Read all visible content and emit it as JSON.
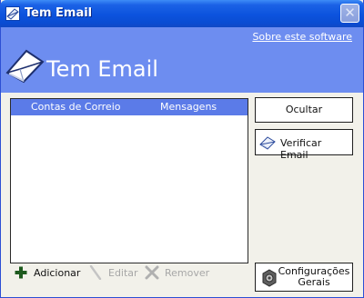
{
  "window": {
    "title": "Tem Email",
    "close_glyph": "✕"
  },
  "banner": {
    "about_link": "Sobre este software",
    "title": "Tem Email"
  },
  "list": {
    "columns": [
      "Contas de Correio",
      "Mensagens"
    ]
  },
  "buttons": {
    "hide": "Ocultar",
    "check": "Verificar Email",
    "settings_line1": "Configurações",
    "settings_line2": "Gerais"
  },
  "toolbar": {
    "add": "Adicionar",
    "edit": "Editar",
    "remove": "Remover"
  },
  "colors": {
    "titlebar": "#0c53dd",
    "banner": "#6d8df0",
    "list_header": "#5b7be8",
    "window_bg": "#f2f1ea",
    "disabled_text": "#a7a7a7"
  },
  "icons": [
    "app-mail-icon",
    "close-icon",
    "mail-logo-icon",
    "check-mail-icon",
    "add-icon",
    "edit-icon",
    "remove-icon",
    "settings-icon"
  ]
}
